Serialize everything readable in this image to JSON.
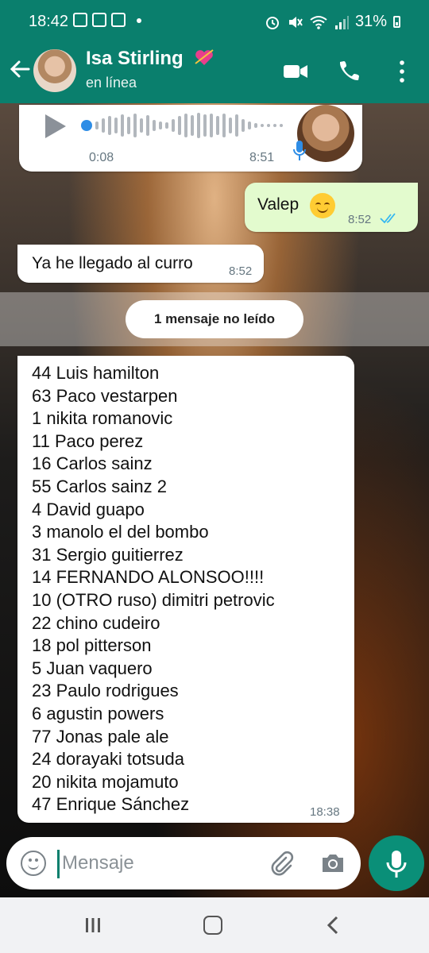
{
  "status_bar": {
    "time": "18:42",
    "battery": "31%"
  },
  "header": {
    "contact_name": "Isa Stirling",
    "contact_status": "en línea"
  },
  "voice_message": {
    "duration": "0:08",
    "time": "8:51"
  },
  "messages": [
    {
      "direction": "out",
      "text": "Valep",
      "emoji": "smiling-face-icon",
      "time": "8:52",
      "status": "read"
    },
    {
      "direction": "in",
      "text": "Ya he llegado al curro",
      "time": "8:52"
    }
  ],
  "unread_banner": "1 mensaje no leído",
  "list_message": {
    "lines": [
      "44 Luis hamilton",
      "63 Paco vestarpen",
      "1 nikita romanovic",
      "11 Paco perez",
      "16 Carlos sainz",
      "55 Carlos sainz 2",
      "4 David guapo",
      "3 manolo el del bombo",
      "31 Sergio guitierrez",
      "14 FERNANDO ALONSOO!!!!",
      "10 (OTRO ruso) dimitri petrovic",
      "22 chino cudeiro",
      "18 pol pitterson",
      "5 Juan vaquero",
      "23 Paulo rodrigues",
      "6 agustin powers",
      "77 Jonas pale ale",
      "24 dorayaki totsuda",
      "20 nikita mojamuto",
      "47 Enrique Sánchez"
    ],
    "time": "18:38"
  },
  "input": {
    "placeholder": "Mensaje"
  },
  "colors": {
    "header": "#0a7f6d",
    "outgoing_bubble": "#e3fbce",
    "incoming_bubble": "#ffffff",
    "accent": "#0a8f78",
    "read_ticks": "#34b7f1"
  }
}
